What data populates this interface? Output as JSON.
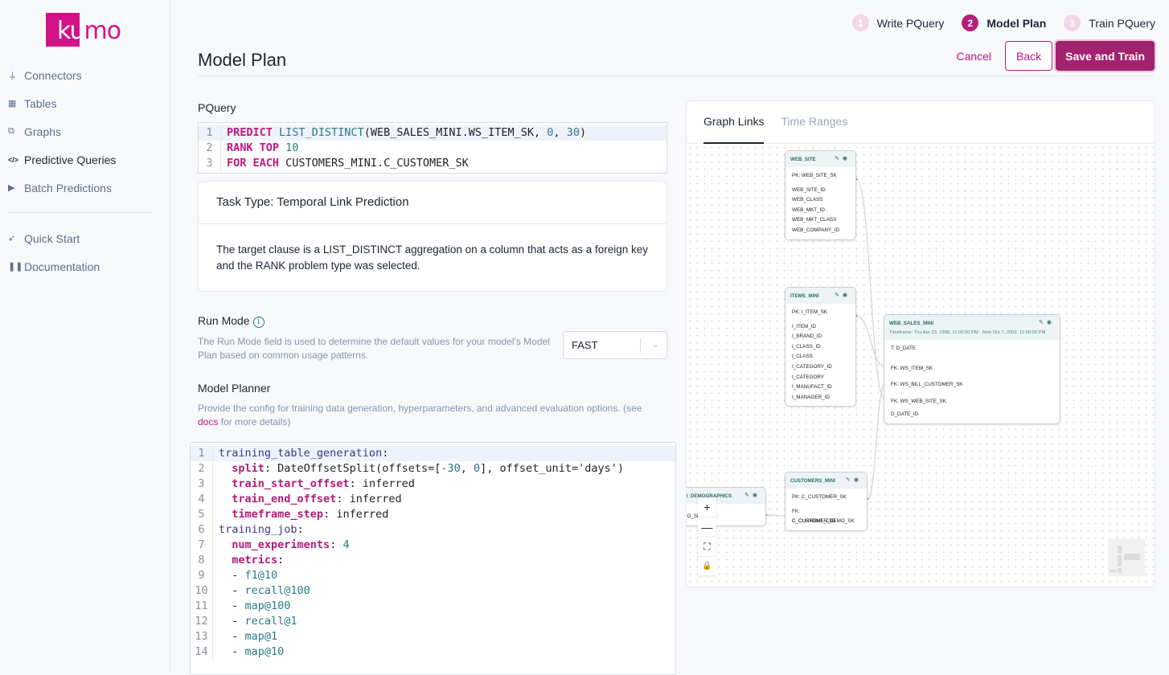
{
  "brand": {
    "logo_text": "kumo",
    "color": "#d3128a"
  },
  "sidebar": {
    "items": [
      {
        "label": "Connectors",
        "icon": "plug-icon"
      },
      {
        "label": "Tables",
        "icon": "table-icon"
      },
      {
        "label": "Graphs",
        "icon": "graph-icon"
      },
      {
        "label": "Predictive Queries",
        "icon": "code-icon",
        "active": true
      },
      {
        "label": "Batch Predictions",
        "icon": "play-icon"
      }
    ],
    "secondary": [
      {
        "label": "Quick Start",
        "icon": "rocket-icon"
      },
      {
        "label": "Documentation",
        "icon": "book-icon"
      }
    ]
  },
  "steps": [
    {
      "num": "1",
      "label": "Write PQuery"
    },
    {
      "num": "2",
      "label": "Model Plan",
      "active": true
    },
    {
      "num": "3",
      "label": "Train PQuery"
    }
  ],
  "actions": {
    "cancel": "Cancel",
    "back": "Back",
    "save": "Save and Train"
  },
  "page_title": "Model Plan",
  "pquery": {
    "label": "PQuery",
    "lines": [
      [
        [
          "PREDICT ",
          "kw"
        ],
        [
          "LIST_DISTINCT",
          "fn"
        ],
        [
          "(WEB_SALES_MINI.WS_ITEM_SK, ",
          "pl"
        ],
        [
          "0",
          "num"
        ],
        [
          ", ",
          "pl"
        ],
        [
          "30",
          "num"
        ],
        [
          ")",
          "pl"
        ]
      ],
      [
        [
          "RANK TOP ",
          "kw"
        ],
        [
          "10",
          "num"
        ]
      ],
      [
        [
          "FOR EACH ",
          "kw"
        ],
        [
          "CUSTOMERS_MINI.C_CUSTOMER_SK",
          "pl"
        ]
      ]
    ]
  },
  "task": {
    "title": "Task Type: Temporal Link Prediction",
    "body": "The target clause is a LIST_DISTINCT aggregation on a column that acts as a foreign key and the RANK problem type was selected."
  },
  "run_mode": {
    "label": "Run Mode",
    "info": "i",
    "desc": "The Run Mode field is used to determine the default values for your model's Model Plan based on common usage patterns.",
    "value": "FAST"
  },
  "planner": {
    "label": "Model Planner",
    "desc": "Provide the config for training data generation, hyperparameters, and advanced evaluation options. (see ",
    "link": "docs",
    "desc_end": " for more details)",
    "lines": [
      [
        [
          "training_table_generation",
          "tk"
        ],
        [
          ":",
          "pl"
        ]
      ],
      [
        [
          "  ",
          "pl"
        ],
        [
          "split",
          "sk"
        ],
        [
          ": DateOffsetSplit(offsets=[",
          "pl"
        ],
        [
          "-30",
          "num"
        ],
        [
          ", ",
          "pl"
        ],
        [
          "0",
          "num"
        ],
        [
          "], offset_unit='days')",
          "pl"
        ]
      ],
      [
        [
          "  ",
          "pl"
        ],
        [
          "train_start_offset",
          "sk"
        ],
        [
          ": inferred",
          "pl"
        ]
      ],
      [
        [
          "  ",
          "pl"
        ],
        [
          "train_end_offset",
          "sk"
        ],
        [
          ": inferred",
          "pl"
        ]
      ],
      [
        [
          "  ",
          "pl"
        ],
        [
          "timeframe_step",
          "sk"
        ],
        [
          ": inferred",
          "pl"
        ]
      ],
      [
        [
          "training_job",
          "tk"
        ],
        [
          ":",
          "pl"
        ]
      ],
      [
        [
          "  ",
          "pl"
        ],
        [
          "num_experiments",
          "sk"
        ],
        [
          ": ",
          "pl"
        ],
        [
          "4",
          "num"
        ]
      ],
      [
        [
          "  ",
          "pl"
        ],
        [
          "metrics",
          "sk"
        ],
        [
          ":",
          "pl"
        ]
      ],
      [
        [
          "  - ",
          "pl"
        ],
        [
          "f1@10",
          "fn"
        ]
      ],
      [
        [
          "  - ",
          "pl"
        ],
        [
          "recall@100",
          "fn"
        ]
      ],
      [
        [
          "  - ",
          "pl"
        ],
        [
          "map@100",
          "fn"
        ]
      ],
      [
        [
          "  - ",
          "pl"
        ],
        [
          "recall@1",
          "fn"
        ]
      ],
      [
        [
          "  - ",
          "pl"
        ],
        [
          "map@1",
          "fn"
        ]
      ],
      [
        [
          "  - ",
          "pl"
        ],
        [
          "map@10",
          "fn"
        ]
      ]
    ]
  },
  "graph": {
    "tabs": [
      {
        "label": "Graph Links",
        "active": true
      },
      {
        "label": "Time Ranges"
      }
    ],
    "nodes": [
      {
        "id": "web_site",
        "title": "WEB_SITE",
        "rows": [
          "PK: WEB_SITE_SK",
          "WEB_SITE_ID",
          "WEB_CLASS",
          "WEB_MKT_ID",
          "WEB_MKT_CLASS",
          "WEB_COMPANY_ID"
        ]
      },
      {
        "id": "items",
        "title": "ITEMS_MINI",
        "rows": [
          "PK: I_ITEM_SK",
          "I_ITEM_ID",
          "I_BRAND_ID",
          "I_CLASS_ID",
          "I_CLASS",
          "I_CATEGORY_ID",
          "I_CATEGORY",
          "I_MANUFACT_ID",
          "I_MANAGER_ID"
        ]
      },
      {
        "id": "web_sales",
        "title": "WEB_SALES_MINI",
        "timeframe": "Timeframe: Thu Apr 23, 1998, 11:00:00 PM - Mon Oct 7, 2002, 11:00:00 PM",
        "rows": [
          "T: D_DATE",
          "FK: WS_ITEM_SK",
          "FK: WS_BILL_CUSTOMER_SK",
          "FK: WS_WEB_SITE_SK",
          "D_DATE_ID"
        ]
      },
      {
        "id": "customers",
        "title": "CUSTOMERS_MINI",
        "rows": [
          "PK: C_CUSTOMER_SK",
          "FK: C_CURRENT_CDEMO_SK",
          "C_CUSTOMER_ID"
        ]
      },
      {
        "id": "demographics",
        "title": "R_DEMOGRAPHICS",
        "rows": [
          "EMO_SK"
        ]
      }
    ],
    "controls": {
      "zoom_in": "+",
      "zoom_out": "—",
      "fit": "⛶",
      "lock": "🔒"
    }
  }
}
